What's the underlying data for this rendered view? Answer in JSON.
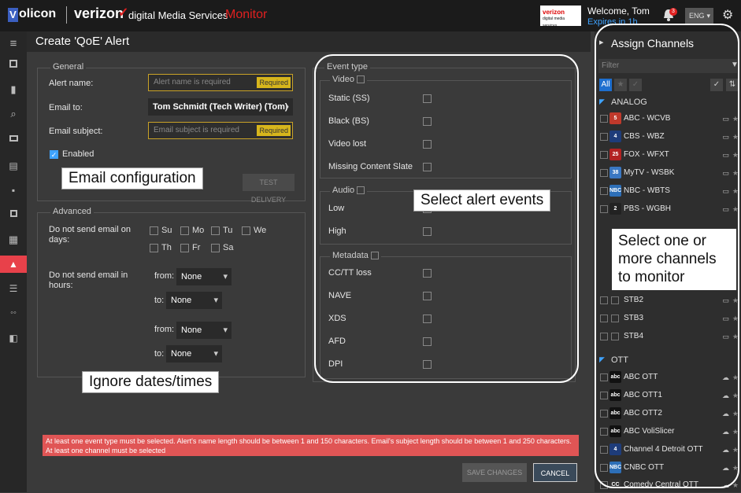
{
  "topbar": {
    "logo_mark": "V",
    "logo_text": "olicon",
    "verizon": "verizon",
    "product": "digital Media Services",
    "app_name": "Monitor",
    "badge_line1": "verizon",
    "badge_line2": "digital media services",
    "welcome": "Welcome, Tom",
    "expires": "Expires in 1h",
    "notifications": "3",
    "language": "ENG"
  },
  "page": {
    "title": "Create 'QoE' Alert"
  },
  "general": {
    "legend": "General",
    "alert_name_label": "Alert name:",
    "alert_name_placeholder": "Alert name is required",
    "required": "Required",
    "email_to_label": "Email to:",
    "email_to_value": "Tom Schmidt (Tech Writer) (Tom)",
    "email_subject_label": "Email subject:",
    "email_subject_placeholder": "Email subject is required",
    "enabled_label": "Enabled",
    "test_delivery": "TEST DELIVERY"
  },
  "advanced": {
    "legend": "Advanced",
    "days_label": "Do not send email on days:",
    "days": [
      "Su",
      "Mo",
      "Tu",
      "We",
      "Th",
      "Fr",
      "Sa"
    ],
    "hours_label": "Do not send email in hours:",
    "from_label": "from:",
    "to_label": "to:",
    "none": "None"
  },
  "event_type": {
    "legend": "Event type",
    "video_legend": "Video",
    "video": [
      "Static (SS)",
      "Black (BS)",
      "Video lost",
      "Missing Content Slate"
    ],
    "audio_legend": "Audio",
    "audio": [
      "Low",
      "High"
    ],
    "metadata_legend": "Metadata",
    "metadata": [
      "CC/TT loss",
      "NAVE",
      "XDS",
      "AFD",
      "DPI"
    ]
  },
  "callouts": {
    "email_config": "Email configuration",
    "select_events": "Select alert events",
    "ignore_dates": "Ignore dates/times",
    "select_channels_1": "Select one or",
    "select_channels_2": "more channels",
    "select_channels_3": "to monitor"
  },
  "error_message": "At least one event type must be selected. Alert's name length should be between 1 and 150 characters. Email's subject length should be between 1 and 250 characters. At least one channel must be selected",
  "buttons": {
    "save": "SAVE CHANGES",
    "cancel": "CANCEL"
  },
  "channels": {
    "title": "Assign Channels",
    "filter_placeholder": "Filter",
    "all": "All",
    "analog_group": "ANALOG",
    "analog": [
      {
        "name": "ABC - WCVB",
        "logo": "5"
      },
      {
        "name": "CBS - WBZ",
        "logo": "4"
      },
      {
        "name": "FOX - WFXT",
        "logo": "25"
      },
      {
        "name": "MyTV - WSBK",
        "logo": "38"
      },
      {
        "name": "NBC - WBTS",
        "logo": "NBC"
      },
      {
        "name": "PBS - WGBH",
        "logo": "2"
      }
    ],
    "stb": [
      "STB2",
      "STB3",
      "STB4"
    ],
    "ott_group": "OTT",
    "ott": [
      {
        "name": "ABC OTT",
        "logo": "abc"
      },
      {
        "name": "ABC OTT1",
        "logo": "abc"
      },
      {
        "name": "ABC OTT2",
        "logo": "abc"
      },
      {
        "name": "ABC VoliSlicer",
        "logo": "abc"
      },
      {
        "name": "Channel 4 Detroit OTT",
        "logo": "4"
      },
      {
        "name": "CNBC OTT",
        "logo": "NBC"
      },
      {
        "name": "Comedy Central OTT",
        "logo": "CC"
      }
    ],
    "colors": {
      "accent": "#3fa3ff",
      "alert": "#e8414a",
      "required": "#d7b61c"
    }
  }
}
